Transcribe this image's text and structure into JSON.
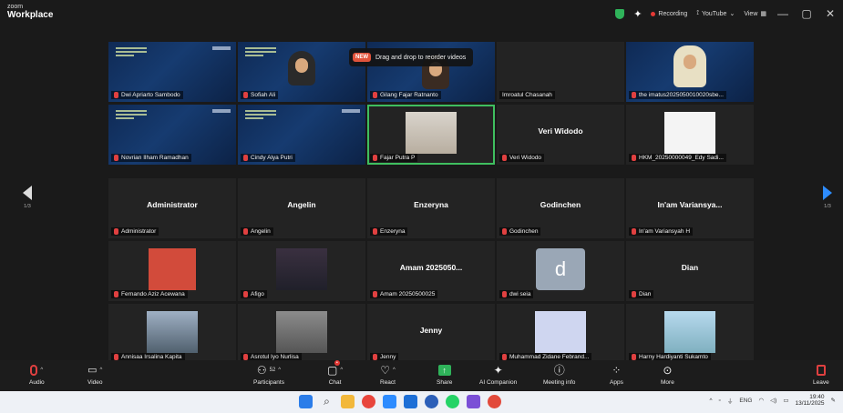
{
  "app": {
    "brand_line1": "zoom",
    "brand_line2": "Workplace"
  },
  "topbar": {
    "recording": "Recording",
    "live_stream": "YouTube",
    "view": "View",
    "minimize": "—",
    "maximize": "▢",
    "close": "✕",
    "colors": {
      "shield": "#2fb35a",
      "recording_dot": "#e53935"
    }
  },
  "drag_tip": {
    "badge": "NEW",
    "text": "Drag and drop to reorder videos"
  },
  "gallery": {
    "left_page": "1/3",
    "right_page": "1/3",
    "active_border_color": "#3fbf5f",
    "tiles": [
      {
        "label": "Dwi Apriarto Sambodo"
      },
      {
        "label": "Sofiah Ali"
      },
      {
        "label": "Gilang Fajar Ratnanto"
      },
      {
        "label": "Imroatul Chasanah"
      },
      {
        "label": "the imatus2025050010020sbe..."
      },
      {
        "label": "Novrian Ilham Ramadhan"
      },
      {
        "label": "Cindy Alya Putri"
      },
      {
        "label": "Fajar Putra P"
      },
      {
        "label": "Veri Widodo",
        "display_name": "Veri Widodo"
      },
      {
        "label": "HKM_20250000049_Edy Sadi..."
      },
      {
        "label": "Administrator",
        "display_name": "Administrator"
      },
      {
        "label": "Angelin",
        "display_name": "Angelin"
      },
      {
        "label": "Enzeryna",
        "display_name": "Enzeryna"
      },
      {
        "label": "Godinchen",
        "display_name": "Godinchen"
      },
      {
        "label": "In'am Variansyah H",
        "display_name": "In'am Variansya..."
      },
      {
        "label": "Fernando Aziz Acewana"
      },
      {
        "label": "Afigo"
      },
      {
        "label": "Amam 20250500025",
        "display_name": "Amam 2025050..."
      },
      {
        "label": "dwi seia",
        "avatar_letter": "d"
      },
      {
        "label": "Dian",
        "display_name": "Dian"
      },
      {
        "label": "Annisaa Irsalina Kapita"
      },
      {
        "label": "Asrotul Iyo Nurlisa"
      },
      {
        "label": "Jenny",
        "display_name": "Jenny"
      },
      {
        "label": "Muhammad Zidane Febrand..."
      },
      {
        "label": "Harny Hardiyanti Sukamto"
      }
    ]
  },
  "toolbar": {
    "audio": "Audio",
    "video": "Video",
    "participants": "Participants",
    "participants_count": "52",
    "chat": "Chat",
    "react": "React",
    "share": "Share",
    "ai_companion": "AI Companion",
    "meeting_info": "Meeting info",
    "apps": "Apps",
    "more": "More",
    "leave": "Leave"
  },
  "taskbar": {
    "lang": "ENG",
    "time": "19:40",
    "date": "13/11/2025"
  }
}
